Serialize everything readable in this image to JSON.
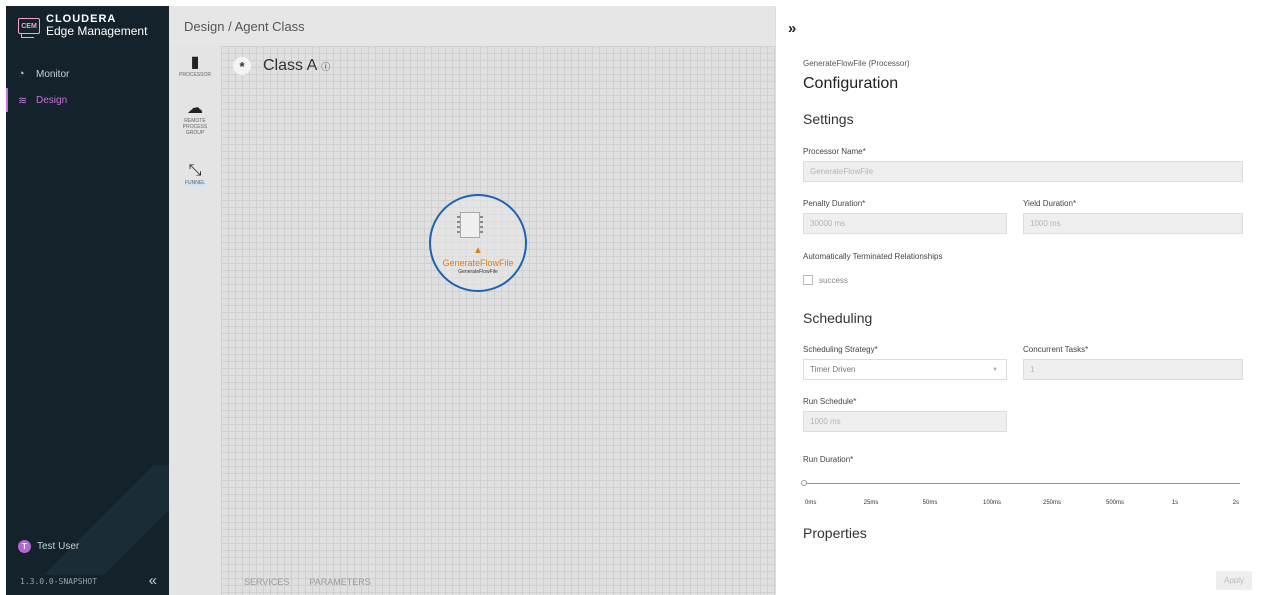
{
  "sidebar": {
    "brand_logo": "CEM",
    "brand_line1": "CLOUDERA",
    "brand_line2": "Edge Management",
    "items": [
      {
        "label": "Monitor",
        "icon": "gauge-icon"
      },
      {
        "label": "Design",
        "icon": "design-icon"
      }
    ],
    "user_initial": "T",
    "user_name": "Test User",
    "version": "1.3.0.0-SNAPSHOT",
    "collapse_glyph": "«"
  },
  "header": {
    "breadcrumb": "Design / Agent Class"
  },
  "palette": {
    "processor": "PROCESSOR",
    "remote_line1": "REMOTE",
    "remote_line2": "PROCESS",
    "remote_line3": "GROUP",
    "funnel": "FUNNEL"
  },
  "canvas": {
    "class_name": "Class A",
    "node_name": "GenerateFlowFile",
    "node_type": "GenerateFlowFile",
    "tabs": [
      "SERVICES",
      "PARAMETERS"
    ]
  },
  "panel": {
    "expand_glyph": "»",
    "subtitle": "GenerateFlowFile (Processor)",
    "title": "Configuration",
    "settings": {
      "heading": "Settings",
      "processor_name_label": "Processor Name*",
      "processor_name_value": "GenerateFlowFile",
      "penalty_label": "Penalty Duration*",
      "penalty_value": "30000 ms",
      "yield_label": "Yield Duration*",
      "yield_value": "1000 ms",
      "auto_term_label": "Automatically Terminated Relationships",
      "relationship": "success"
    },
    "scheduling": {
      "heading": "Scheduling",
      "strategy_label": "Scheduling Strategy*",
      "strategy_value": "Timer Driven",
      "tasks_label": "Concurrent Tasks*",
      "tasks_value": "1",
      "run_schedule_label": "Run Schedule*",
      "run_schedule_value": "1000 ms",
      "run_duration_label": "Run Duration*",
      "run_duration_ticks": [
        "0ms",
        "25ms",
        "50ms",
        "100ms",
        "250ms",
        "500ms",
        "1s",
        "2s"
      ],
      "run_duration_selected": "0ms"
    },
    "properties_heading": "Properties",
    "apply_label": "Apply"
  }
}
